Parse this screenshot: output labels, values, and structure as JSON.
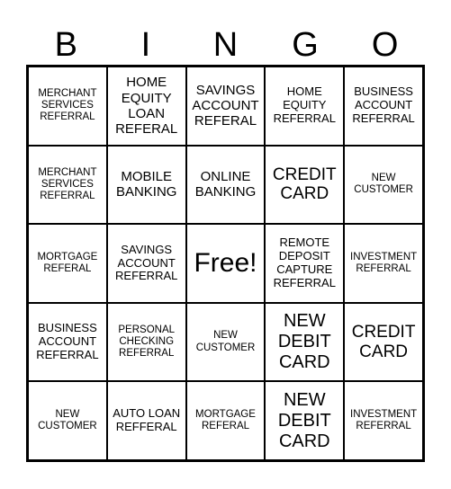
{
  "header": {
    "letters": [
      "B",
      "I",
      "N",
      "G",
      "O"
    ]
  },
  "rows": [
    [
      {
        "text": "MERCHANT SERVICES REFERRAL",
        "size": "xs"
      },
      {
        "text": "HOME EQUITY LOAN REFERAL",
        "size": "md"
      },
      {
        "text": "SAVINGS ACCOUNT REFERAL",
        "size": "md"
      },
      {
        "text": "HOME EQUITY REFERRAL",
        "size": "sm"
      },
      {
        "text": "BUSINESS ACCOUNT REFERRAL",
        "size": "sm"
      }
    ],
    [
      {
        "text": "MERCHANT SERVICES REFERRAL",
        "size": "xs"
      },
      {
        "text": "MOBILE BANKING",
        "size": "md"
      },
      {
        "text": "ONLINE BANKING",
        "size": "md"
      },
      {
        "text": "CREDIT CARD",
        "size": "lg"
      },
      {
        "text": "NEW CUSTOMER",
        "size": "xs"
      }
    ],
    [
      {
        "text": "MORTGAGE REFERAL",
        "size": "xs"
      },
      {
        "text": "SAVINGS ACCOUNT REFERRAL",
        "size": "sm"
      },
      {
        "text": "Free!",
        "size": "free"
      },
      {
        "text": "REMOTE DEPOSIT CAPTURE REFERRAL",
        "size": "sm"
      },
      {
        "text": "INVESTMENT REFERRAL",
        "size": "xs"
      }
    ],
    [
      {
        "text": "BUSINESS ACCOUNT REFERRAL",
        "size": "sm"
      },
      {
        "text": "PERSONAL CHECKING REFERRAL",
        "size": "xs"
      },
      {
        "text": "NEW CUSTOMER",
        "size": "xs"
      },
      {
        "text": "NEW DEBIT CARD",
        "size": "xl"
      },
      {
        "text": "CREDIT CARD",
        "size": "lg"
      }
    ],
    [
      {
        "text": "NEW CUSTOMER",
        "size": "xs"
      },
      {
        "text": "AUTO LOAN REFFERAL",
        "size": "sm"
      },
      {
        "text": "MORTGAGE REFERAL",
        "size": "xs"
      },
      {
        "text": "NEW DEBIT CARD",
        "size": "xl"
      },
      {
        "text": "INVESTMENT REFERRAL",
        "size": "xs"
      }
    ]
  ]
}
